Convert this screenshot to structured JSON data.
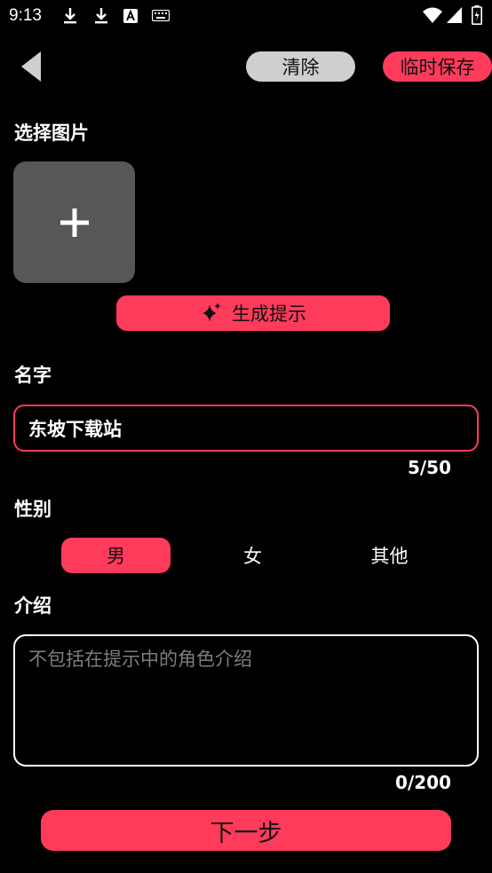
{
  "status_bar": {
    "time": "9:13",
    "icons": [
      "download-icon",
      "download-icon",
      "font-a-icon",
      "keyboard-icon",
      "wifi-icon",
      "signal-icon",
      "battery-charging-icon"
    ]
  },
  "toolbar": {
    "clear_label": "清除",
    "temp_save_label": "临时保存"
  },
  "sections": {
    "select_image": "选择图片",
    "name": "名字",
    "gender": "性别",
    "intro": "介绍"
  },
  "generate_button_label": "生成提示",
  "name_field": {
    "value": "东坡下载站",
    "counter": "5/50"
  },
  "gender_options": [
    "男",
    "女",
    "其他"
  ],
  "gender_selected": "男",
  "intro_field": {
    "placeholder": "不包括在提示中的角色介绍",
    "counter": "0/200"
  },
  "next_button_label": "下一步",
  "colors": {
    "accent": "#ff3b5c",
    "background": "#000000",
    "clear_button": "#cfcfcf",
    "image_placeholder": "#575757"
  }
}
